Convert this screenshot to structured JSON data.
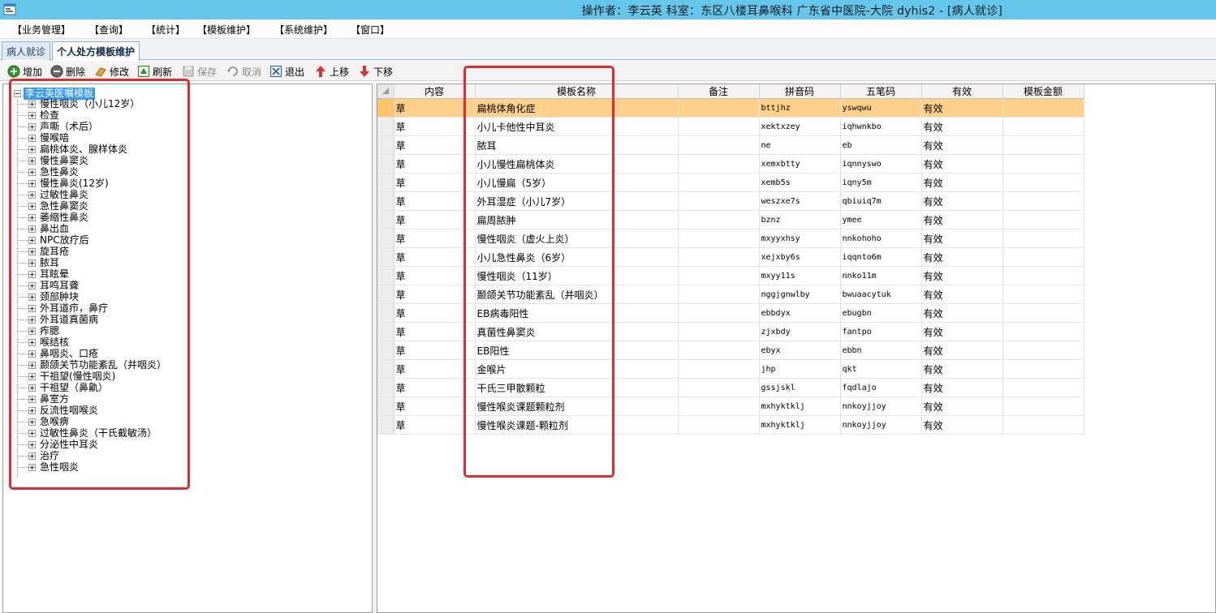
{
  "window": {
    "title": "操作者：李云英  科室：东区八楼耳鼻喉科  广东省中医院-大院 dyhis2 - [病人就诊]",
    "app_icon": "app-icon"
  },
  "menu": [
    "【业务管理】",
    "【查询】",
    "【统计】",
    "【模板维护】",
    "【系统维护】",
    "【窗口】"
  ],
  "tabs": [
    {
      "label": "病人就诊",
      "active": false
    },
    {
      "label": "个人处方模板维护",
      "active": true
    }
  ],
  "toolbar": [
    {
      "label": "增加",
      "icon": "add-icon",
      "enabled": true
    },
    {
      "label": "删除",
      "icon": "delete-icon",
      "enabled": true
    },
    {
      "label": "修改",
      "icon": "edit-icon",
      "enabled": true
    },
    {
      "label": "刷新",
      "icon": "refresh-icon",
      "enabled": true
    },
    {
      "label": "保存",
      "icon": "save-icon",
      "enabled": false
    },
    {
      "label": "取消",
      "icon": "undo-icon",
      "enabled": false
    },
    {
      "label": "退出",
      "icon": "exit-icon",
      "enabled": true
    },
    {
      "label": "上移",
      "icon": "arrow-up-icon",
      "enabled": true
    },
    {
      "label": "下移",
      "icon": "arrow-down-icon",
      "enabled": true
    }
  ],
  "tree": {
    "root": "李云英医嘱模板",
    "items": [
      "慢性咽炎（小儿12岁）",
      "检查",
      "声嘶（术后）",
      "慢喉喑",
      "扁桃体炎、腺样体炎",
      "慢性鼻窦炎",
      "急性鼻炎",
      "慢性鼻炎(12岁)",
      "过敏性鼻炎",
      "急性鼻窦炎",
      "萎缩性鼻炎",
      "鼻出血",
      "NPC放疗后",
      "旋耳疮",
      "脓耳",
      "耳眩晕",
      "耳鸣耳聋",
      "颈部肿块",
      "外耳道疖，鼻疔",
      "外耳道真菌病",
      "痄腮",
      "喉结核",
      "鼻咽炎、口疮",
      "颞颌关节功能紊乱（并咽炎）",
      "干祖望(慢性咽炎)",
      "干祖望（鼻鼽）",
      "鼻室方",
      "反流性咽喉炎",
      "急喉痹",
      "过敏性鼻炎（干氏截敏汤）",
      "分泌性中耳炎",
      "治疗",
      "急性咽炎"
    ]
  },
  "grid": {
    "columns": [
      "内容",
      "模板名称",
      "备注",
      "拼音码",
      "五笔码",
      "有效",
      "模板金额"
    ],
    "selected_row": 0,
    "rows": [
      [
        "草",
        "扁桃体角化症",
        "",
        "bttjhz",
        "yswqwu",
        "有效",
        ""
      ],
      [
        "草",
        "小儿卡他性中耳炎",
        "",
        "xektxzey",
        "iqhwnkbo",
        "有效",
        ""
      ],
      [
        "草",
        "脓耳",
        "",
        "ne",
        "eb",
        "有效",
        ""
      ],
      [
        "草",
        "小儿慢性扁桃体炎",
        "",
        "xemxbtty",
        "iqnnyswo",
        "有效",
        ""
      ],
      [
        "草",
        "小儿慢扁（5岁）",
        "",
        "xemb5s",
        "iqny5m",
        "有效",
        ""
      ],
      [
        "草",
        "外耳湿症（小儿7岁）",
        "",
        "weszxe7s",
        "qbiuiq7m",
        "有效",
        ""
      ],
      [
        "草",
        "扁周脓肿",
        "",
        "bznz",
        "ymee",
        "有效",
        ""
      ],
      [
        "草",
        "慢性咽炎（虚火上炎）",
        "",
        "mxyyxhsy",
        "nnkohoho",
        "有效",
        ""
      ],
      [
        "草",
        "小儿急性鼻炎（6岁）",
        "",
        "xejxby6s",
        "iqqnto6m",
        "有效",
        ""
      ],
      [
        "草",
        "慢性咽炎（11岁）",
        "",
        "mxyy11s",
        "nnko11m",
        "有效",
        ""
      ],
      [
        "草",
        "颞颌关节功能紊乱（并咽炎）",
        "",
        "nggjgnwlby",
        "bwuaacytuk",
        "有效",
        ""
      ],
      [
        "草",
        "EB病毒阳性",
        "",
        "ebbdyx",
        "ebugbn",
        "有效",
        ""
      ],
      [
        "草",
        "真菌性鼻窦炎",
        "",
        "zjxbdy",
        "fantpo",
        "有效",
        ""
      ],
      [
        "草",
        "EB阳性",
        "",
        "ebyx",
        "ebbn",
        "有效",
        ""
      ],
      [
        "草",
        "金喉片",
        "",
        "jhp",
        "qkt",
        "有效",
        ""
      ],
      [
        "草",
        "干氏三甲散颗粒",
        "",
        "gssjskl",
        "fqdlajo",
        "有效",
        ""
      ],
      [
        "草",
        "慢性喉炎课题颗粒剂",
        "",
        "mxhyktklj",
        "nnkoyjjoy",
        "有效",
        ""
      ],
      [
        "草",
        "慢性喉炎课题-颗粒剂",
        "",
        "mxhyktklj",
        "nnkoyjjoy",
        "有效",
        ""
      ]
    ]
  },
  "colors": {
    "titlebar": "#63c6ea",
    "selected_row": "#ffd08a",
    "tree_root_highlight": "#3399ff",
    "annotation_box": "#e32b2b"
  }
}
